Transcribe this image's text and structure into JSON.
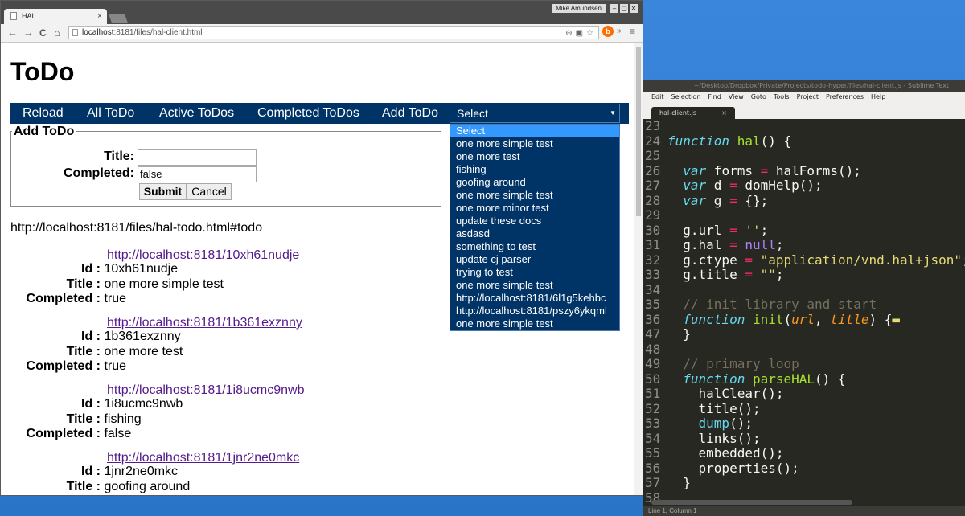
{
  "browser": {
    "tab_title": "HAL",
    "tab_close": "×",
    "user": "Mike Amundsen",
    "wm_buttons": [
      "–",
      "▢",
      "✕"
    ],
    "url_host": "localhost",
    "url_path": ":8181/files/hal-client.html",
    "nav": {
      "back": "←",
      "forward": "→",
      "reload": "C",
      "home": "⌂"
    },
    "ext_label": "b",
    "overflow": "»",
    "menu": "≡"
  },
  "page": {
    "title": "ToDo",
    "menu": {
      "items": [
        "Reload",
        "All ToDo",
        "Active ToDos",
        "Completed ToDos",
        "Add ToDo"
      ],
      "select_value": "Select",
      "select_arrow": "▼"
    },
    "dropdown_options": [
      "Select",
      "one more simple test",
      "one more test",
      "fishing",
      "goofing around",
      "one more simple test",
      "one more minor test",
      "update these docs",
      "asdasd",
      "something to test",
      "update cj parser",
      "trying to test",
      "one more simple test",
      "http://localhost:8181/6l1g5kehbc",
      "http://localhost:8181/pszy6ykqml",
      "one more simple test"
    ],
    "form": {
      "legend": "Add ToDo",
      "title_label": "Title:",
      "title_value": "",
      "completed_label": "Completed:",
      "completed_value": "false",
      "submit": "Submit",
      "cancel": "Cancel"
    },
    "current_url": "http://localhost:8181/files/hal-todo.html#todo",
    "items": [
      {
        "href": "http://localhost:8181/10xh61nudje",
        "id": "10xh61nudje",
        "title": "one more simple test",
        "completed": "true"
      },
      {
        "href": "http://localhost:8181/1b361exznny",
        "id": "1b361exznny",
        "title": "one more test",
        "completed": "true"
      },
      {
        "href": "http://localhost:8181/1i8ucmc9nwb",
        "id": "1i8ucmc9nwb",
        "title": "fishing",
        "completed": "false"
      },
      {
        "href": "http://localhost:8181/1jnr2ne0mkc",
        "id": "1jnr2ne0mkc",
        "title": "goofing around",
        "completed": ""
      }
    ],
    "labels": {
      "id": "Id :",
      "title": "Title :",
      "completed": "Completed :"
    }
  },
  "editor": {
    "window_title": "~/Desktop/Dropbox/Private/Projects/todo-hyper/files/hal-client.js - Sublime Text",
    "menu": [
      "Edit",
      "Selection",
      "Find",
      "View",
      "Goto",
      "Tools",
      "Project",
      "Preferences",
      "Help"
    ],
    "tab": "hal-client.js",
    "tab_close": "×",
    "line_numbers": [
      "23",
      "24",
      "25",
      "26",
      "27",
      "28",
      "29",
      "30",
      "31",
      "32",
      "33",
      "34",
      "35",
      "36",
      "47",
      "48",
      "49",
      "50",
      "51",
      "52",
      "53",
      "54",
      "55",
      "56",
      "57",
      "58"
    ],
    "status": "Line 1, Column 1"
  }
}
